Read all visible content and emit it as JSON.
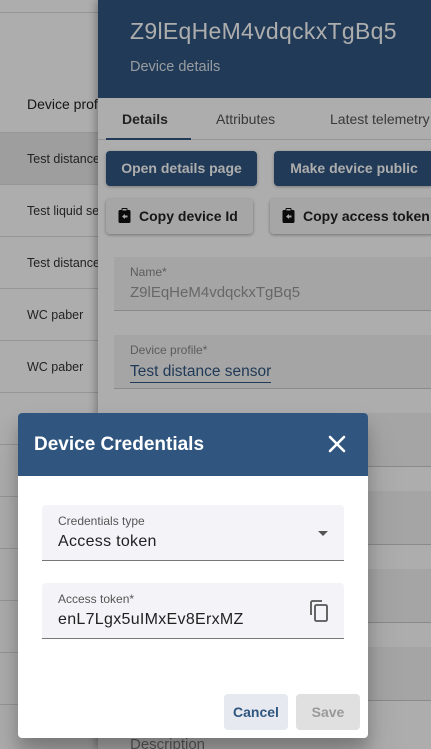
{
  "table": {
    "header": "Device profile",
    "rows": [
      "Test distance sensor",
      "Test liquid sensor",
      "Test distance sensor",
      "WC paber",
      "WC paber"
    ]
  },
  "drawer": {
    "title": "Z9lEqHeM4vdqckxTgBq5",
    "subtitle": "Device details",
    "tabs": [
      "Details",
      "Attributes",
      "Latest telemetry"
    ],
    "buttons": {
      "open_details": "Open details page",
      "make_public": "Make device public",
      "copy_device_id": "Copy device Id",
      "copy_access_token": "Copy access token"
    },
    "fields": {
      "name_label": "Name*",
      "name_value": "Z9lEqHeM4vdqckxTgBq5",
      "profile_label": "Device profile*",
      "profile_value": "Test distance sensor",
      "description_label": "Description"
    }
  },
  "dialog": {
    "title": "Device Credentials",
    "credentials_type_label": "Credentials type",
    "credentials_type_value": "Access token",
    "access_token_label": "Access token*",
    "access_token_value": "enL7Lgx5uIMxEv8ErxMZ",
    "cancel_label": "Cancel",
    "save_label": "Save"
  },
  "colors": {
    "primary": "#305680"
  },
  "icons": {
    "close": "close-icon",
    "copy": "copy-icon",
    "clipboard": "clipboard-icon",
    "dropdown": "chevron-down-icon"
  }
}
